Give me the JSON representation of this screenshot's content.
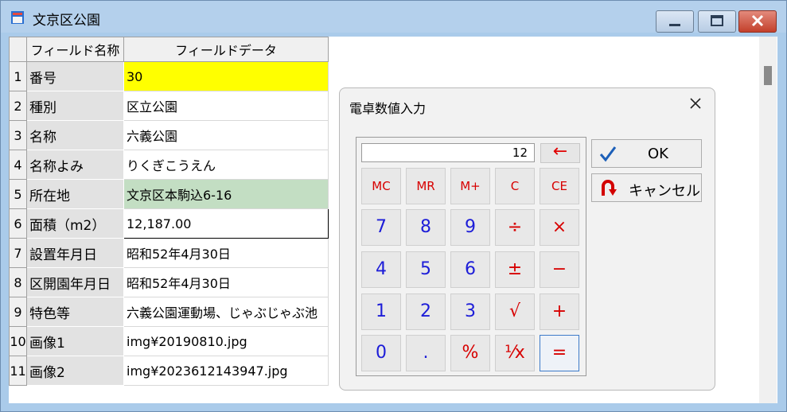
{
  "window": {
    "title": "文京区公園"
  },
  "grid": {
    "headers": {
      "name": "フィールド名称",
      "data": "フィールドデータ"
    },
    "rows": [
      {
        "num": "1",
        "name": "番号",
        "value": "30"
      },
      {
        "num": "2",
        "name": "種別",
        "value": "区立公園"
      },
      {
        "num": "3",
        "name": "名称",
        "value": "六義公園"
      },
      {
        "num": "4",
        "name": "名称よみ",
        "value": "りくぎこうえん"
      },
      {
        "num": "5",
        "name": "所在地",
        "value": "文京区本駒込6-16"
      },
      {
        "num": "6",
        "name": "面積（m2）",
        "value": "12,187.00"
      },
      {
        "num": "7",
        "name": "設置年月日",
        "value": "昭和52年4月30日"
      },
      {
        "num": "8",
        "name": "区開園年月日",
        "value": "昭和52年4月30日"
      },
      {
        "num": "9",
        "name": "特色等",
        "value": "六義公園運動場、じゃぶじゃぶ池"
      },
      {
        "num": "10",
        "name": "画像1",
        "value": "img¥20190810.jpg"
      },
      {
        "num": "11",
        "name": "画像2",
        "value": "img¥2023612143947.jpg"
      }
    ]
  },
  "calculator": {
    "title": "電卓数値入力",
    "display": "12",
    "backspace": "←",
    "memory": [
      "MC",
      "MR",
      "M+",
      "C",
      "CE"
    ],
    "keys": {
      "k7": "7",
      "k8": "8",
      "k9": "9",
      "div": "÷",
      "mul": "×",
      "k4": "4",
      "k5": "5",
      "k6": "6",
      "pm": "±",
      "minus": "−",
      "k1": "1",
      "k2": "2",
      "k3": "3",
      "sqrt": "√",
      "plus": "+",
      "k0": "0",
      "dot": ".",
      "pct": "%",
      "inv": "⅟x",
      "eq": "="
    },
    "ok": "OK",
    "cancel": "キャンセル"
  }
}
